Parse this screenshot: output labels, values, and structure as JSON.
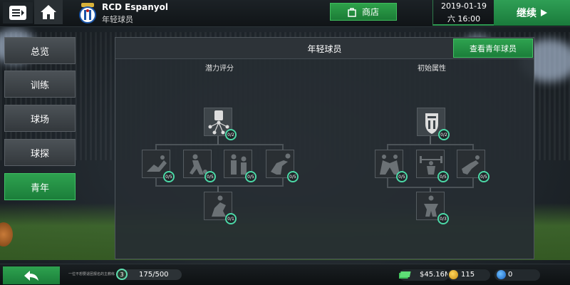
{
  "header": {
    "club_name": "RCD Espanyol",
    "page_subtitle": "年轻球员",
    "shop_label": "商店",
    "date": "2019-01-19",
    "time": "六 16:00",
    "continue_label": "继续"
  },
  "sidebar": {
    "items": [
      {
        "label": "总览"
      },
      {
        "label": "训练"
      },
      {
        "label": "球场"
      },
      {
        "label": "球探"
      },
      {
        "label": "青年"
      }
    ],
    "active_index": 4
  },
  "panel": {
    "title": "年轻球员",
    "view_youth_label": "查看青年球员",
    "potential": {
      "title": "潜力评分",
      "root": {
        "icon": "network-crest-icon",
        "progress": "0/2"
      },
      "children": [
        {
          "icon": "tackle-player-icon",
          "progress": "0/5"
        },
        {
          "icon": "dribble-player-icon",
          "progress": "0/5"
        },
        {
          "icon": "duo-players-icon",
          "progress": "0/5"
        },
        {
          "icon": "header-player-icon",
          "progress": "0/5"
        }
      ],
      "leaf": {
        "icon": "trophy-player-icon",
        "progress": "0/1"
      }
    },
    "initial": {
      "title": "初始属性",
      "root": {
        "icon": "crest-icon",
        "progress": "0/2"
      },
      "children": [
        {
          "icon": "scrum-players-icon",
          "progress": "0/5"
        },
        {
          "icon": "weightlifting-icon",
          "progress": "0/5"
        },
        {
          "icon": "diving-keeper-icon",
          "progress": "0/5"
        }
      ],
      "leaf": {
        "icon": "fitness-player-icon",
        "progress": "0/3"
      }
    }
  },
  "footer": {
    "tip": "一位不想要退团报名的主教练",
    "xp_icon_label": "3",
    "xp_text": "175/500",
    "money": "$45.16M",
    "coins": "115",
    "gems": "0"
  },
  "colors": {
    "accent_green": "#2ea24f",
    "badge_ring": "#4cd9a7"
  }
}
